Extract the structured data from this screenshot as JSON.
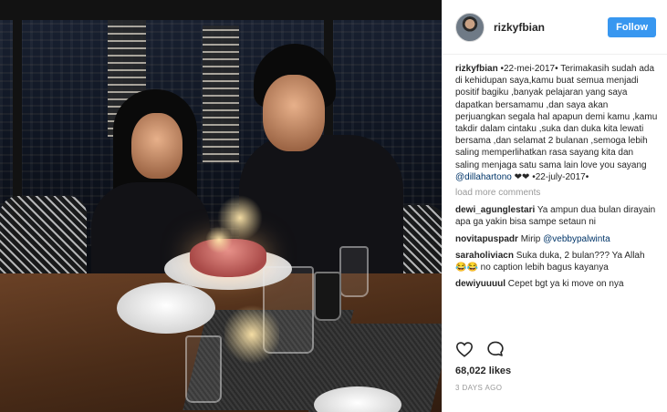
{
  "post": {
    "username": "rizkyfbian",
    "follow_label": "Follow",
    "caption": {
      "username": "rizkyfbian",
      "text": "•22-mei-2017• Terimakasih sudah ada di kehidupan saya,kamu buat semua menjadi positif bagiku ,banyak pelajaran yang saya dapatkan bersamamu ,dan saya akan perjuangkan segala hal apapun demi kamu ,kamu takdir dalam cintaku ,suka dan duka kita lewati bersama ,dan selamat 2 bulanan ,semoga lebih saling memperlihatkan rasa sayang kita dan saling menjaga satu sama lain love you sayang",
      "mention": "@dillahartono",
      "emoji": "❤❤",
      "tail": "•22-july-2017•"
    },
    "load_more": "load more comments",
    "comments": [
      {
        "user": "dewi_agunglestari",
        "text": "Ya ampun dua bulan dirayain apa ga yakin bisa sampe setaun ni"
      },
      {
        "user": "novitapuspadr",
        "text": "Mirip",
        "mention": "@vebbypalwinta"
      },
      {
        "user": "saraholiviacn",
        "text": "Suka duka, 2 bulan??? Ya Allah 😂😂 no caption lebih bagus kayanya"
      },
      {
        "user": "dewiyuuuul",
        "text": "Cepet bgt ya ki move on nya"
      }
    ],
    "likes": "68,022 likes",
    "timestamp": "3 DAYS AGO",
    "icons": {
      "like": "heart-icon",
      "comment": "comment-bubble-icon"
    },
    "colors": {
      "follow_button": "#3897f0",
      "mention": "#003569",
      "muted": "#999999"
    }
  }
}
